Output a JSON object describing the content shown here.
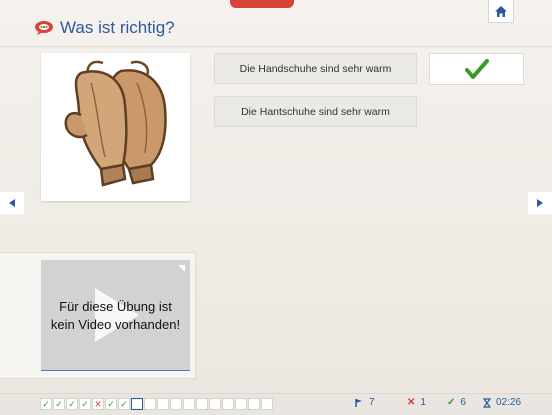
{
  "header": {
    "title": "Was ist richtig?",
    "home_icon": "home-icon",
    "speech_icon": "speech-bubble-icon"
  },
  "answers": [
    {
      "label": "Die Handschuhe sind sehr warm"
    },
    {
      "label": "Die Hantschuhe sind sehr warm"
    }
  ],
  "result": {
    "icon": "checkmark-icon",
    "state": "correct"
  },
  "image": {
    "subject": "gloves-illustration"
  },
  "video": {
    "message_line1": "Für diese Übung ist",
    "message_line2": "kein Video vorhanden!"
  },
  "progress": {
    "cells": [
      "ok",
      "ok",
      "ok",
      "ok",
      "err",
      "ok",
      "ok",
      "current",
      "",
      "",
      "",
      "",
      "",
      "",
      "",
      "",
      "",
      ""
    ]
  },
  "stats": {
    "flags": "7",
    "wrong": "1",
    "correct": "6",
    "time": "02:26"
  },
  "colors": {
    "accent": "#2c5aa0",
    "success": "#3a9a2a",
    "error": "#d9423a"
  }
}
